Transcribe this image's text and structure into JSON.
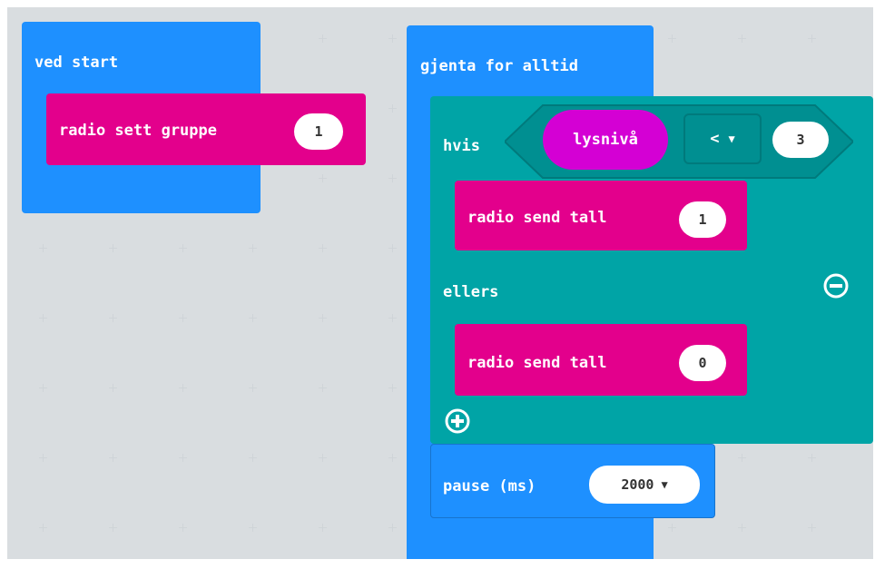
{
  "colors": {
    "workspace_bg": "#eceff1",
    "basic_blue": "#1e90ff",
    "radio_pink": "#e3008c",
    "logic_teal": "#00a4a6",
    "input_purple": "#d400d4"
  },
  "on_start": {
    "label": "ved start",
    "radio_set_group": {
      "label": "radio sett gruppe",
      "value": "1"
    }
  },
  "forever": {
    "label": "gjenta for alltid",
    "if_block": {
      "if_label": "hvis",
      "condition": {
        "left": "lysnivå",
        "operator": "<",
        "right": "3"
      },
      "then_send": {
        "label": "radio send tall",
        "value": "1"
      },
      "else_label": "ellers",
      "else_send": {
        "label": "radio send tall",
        "value": "0"
      },
      "minus_icon": "remove-else-icon",
      "plus_icon": "add-else-icon"
    },
    "pause": {
      "label": "pause (ms)",
      "value": "2000"
    }
  }
}
